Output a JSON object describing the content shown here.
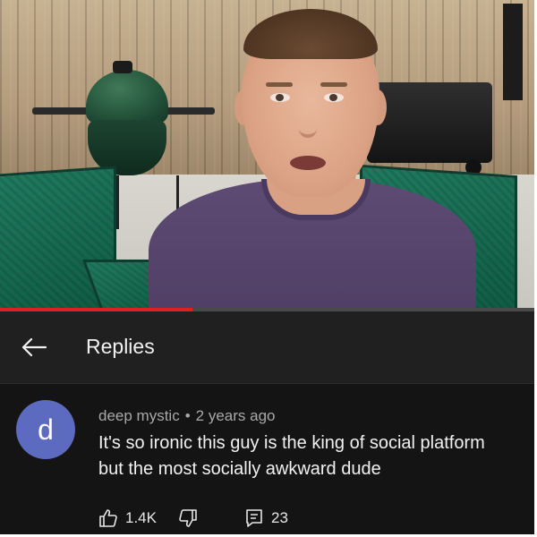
{
  "video": {
    "progress": 0.36,
    "progress_color": "#e02020"
  },
  "header": {
    "back_icon": "arrow-left-icon",
    "title": "Replies"
  },
  "comment": {
    "avatar_letter": "d",
    "avatar_color": "#5c6bc0",
    "author": "deep mystic",
    "separator": "•",
    "time": "2 years ago",
    "text_lines": [
      "It's so ironic this guy is the king of social platform",
      "but the most socially awkward dude"
    ],
    "likes": "1.4K",
    "replies": "23",
    "icons": {
      "like": "thumbs-up-icon",
      "dislike": "thumbs-down-icon",
      "reply": "reply-comment-icon"
    }
  }
}
